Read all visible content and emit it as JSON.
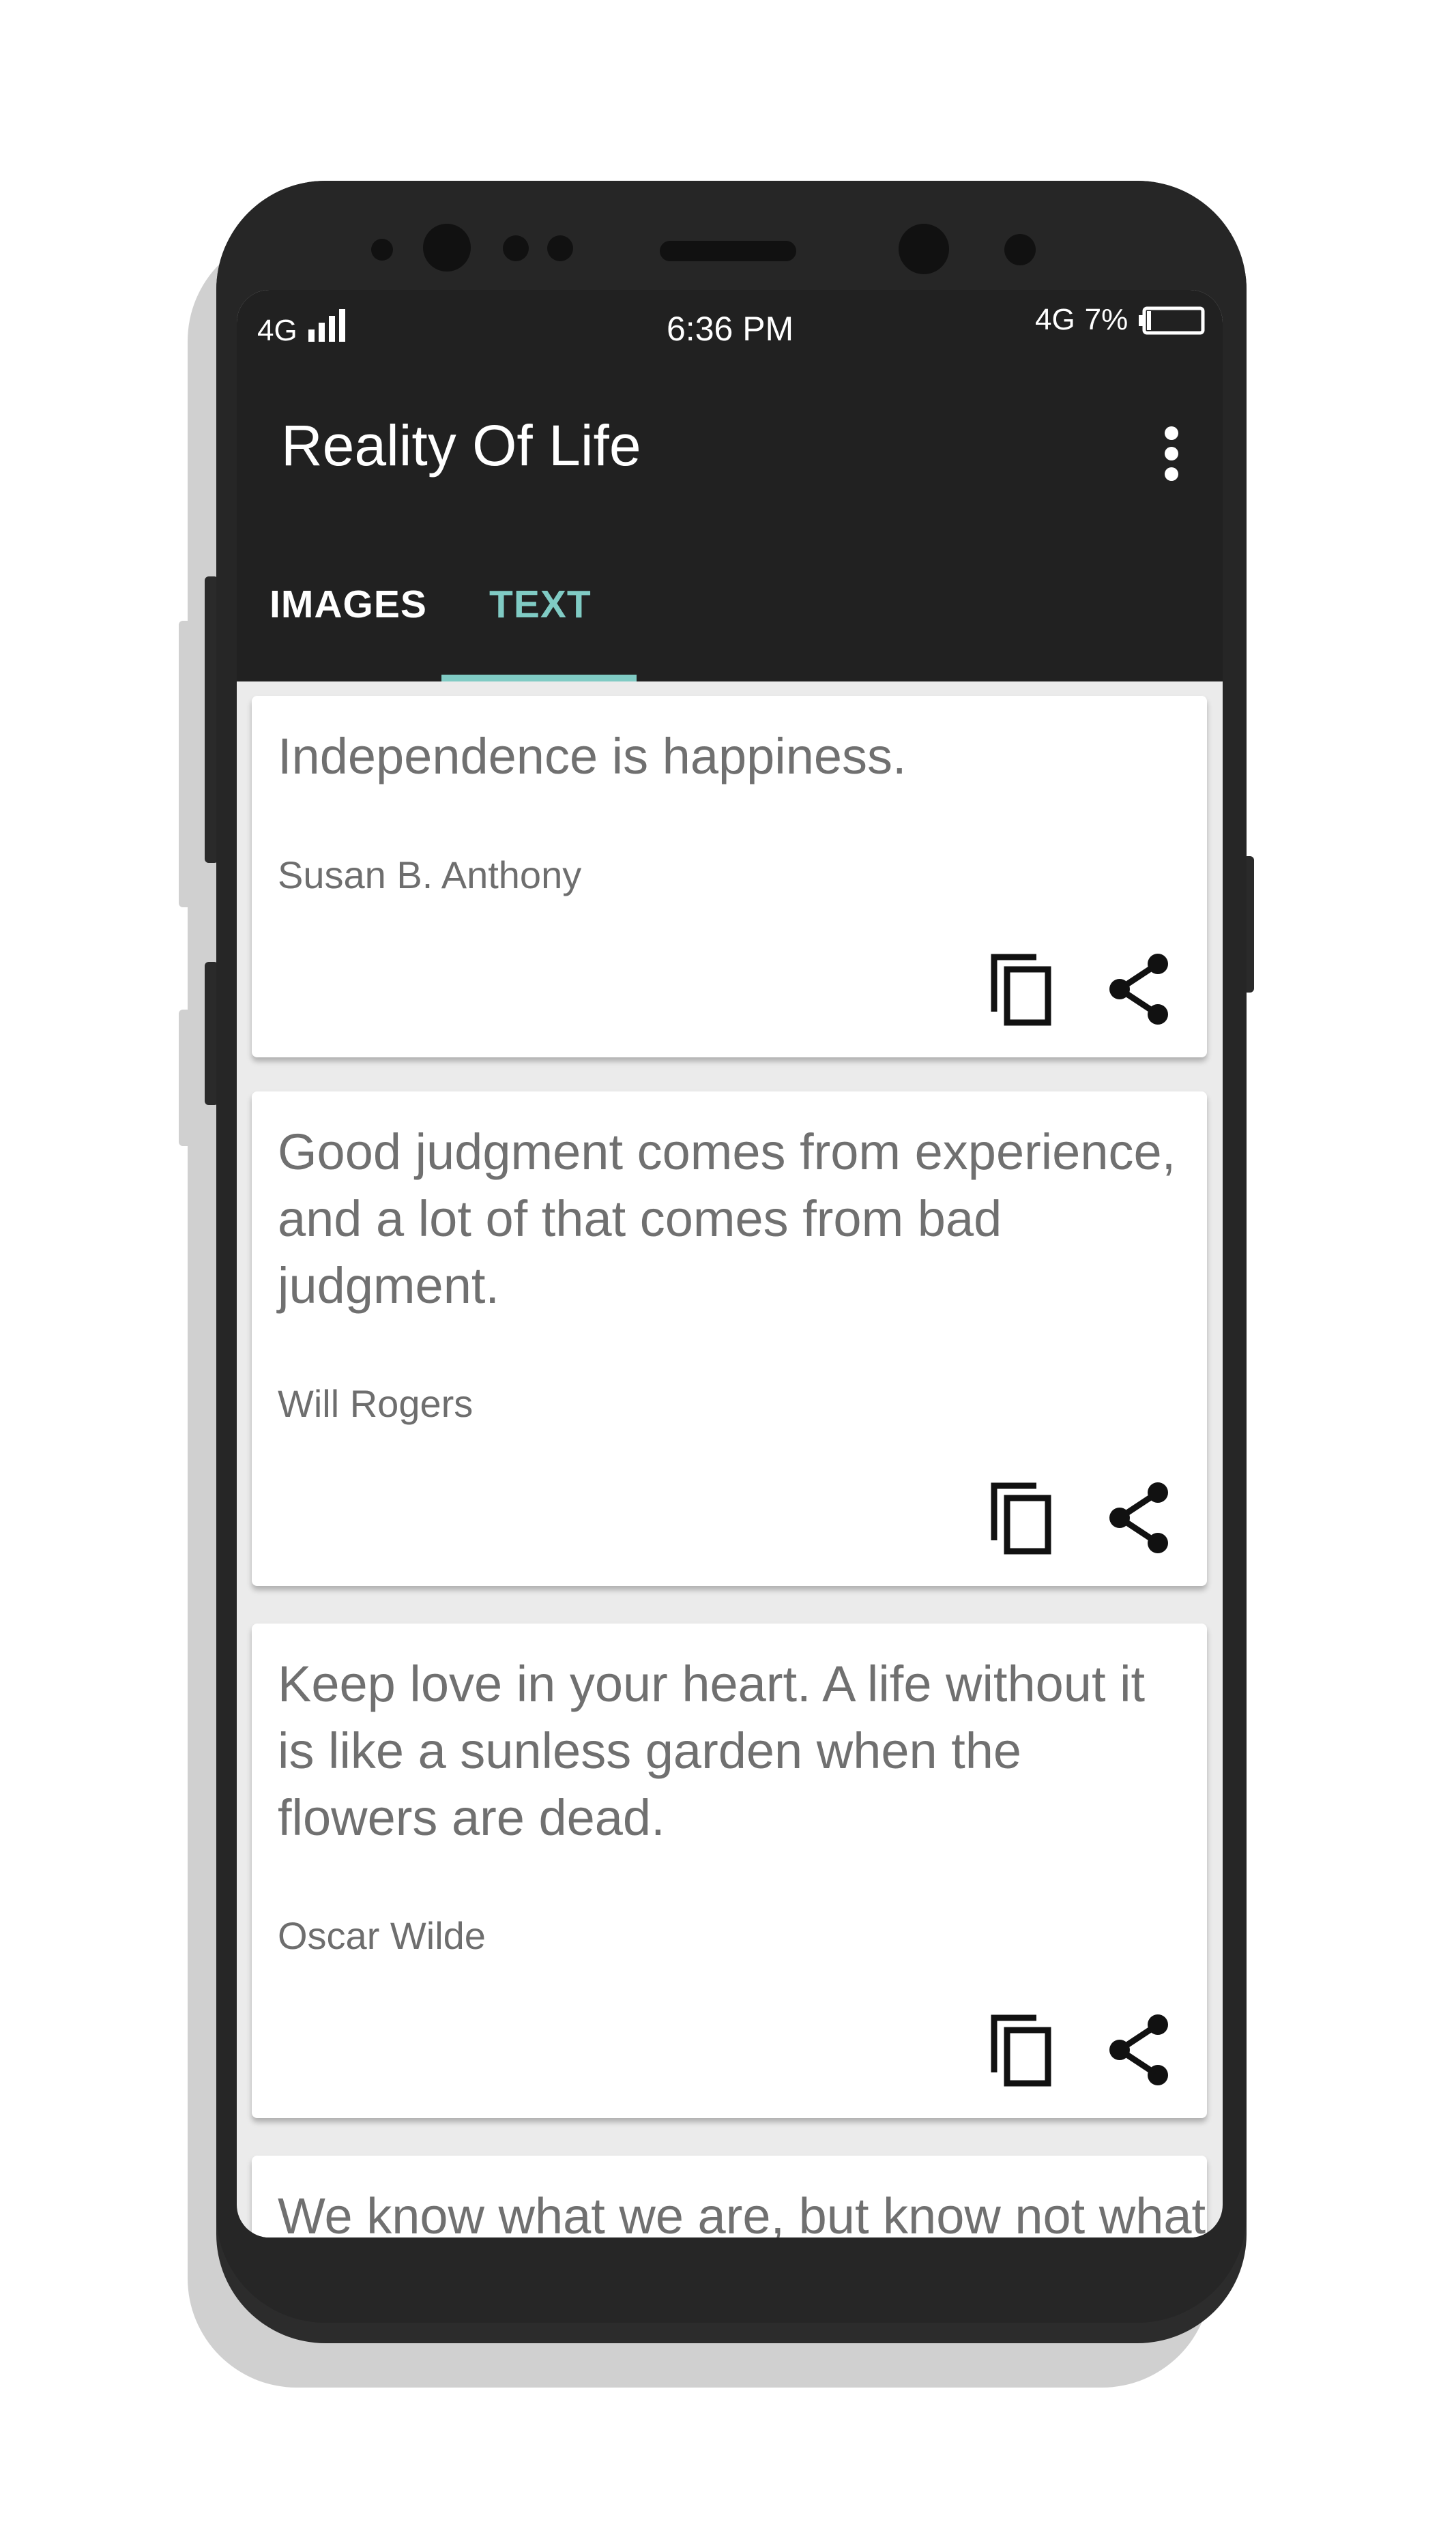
{
  "status_bar": {
    "network": "4G",
    "time": "6:36 PM",
    "data": "4G",
    "battery": "7%"
  },
  "app": {
    "title": "Reality Of Life",
    "menu_icon": "more-vert-icon"
  },
  "tabs": [
    {
      "label": "IMAGES",
      "selected": false
    },
    {
      "label": "TEXT",
      "selected": true
    }
  ],
  "colors": {
    "accent": "#80cbc4",
    "appbar": "#212121"
  },
  "quotes": [
    {
      "text": "Independence is happiness.",
      "author": "Susan B. Anthony",
      "actions": [
        "copy-icon",
        "share-icon"
      ]
    },
    {
      "text": "Good judgment comes from experience, and a lot of that comes from bad judgment.",
      "author": "Will Rogers",
      "actions": [
        "copy-icon",
        "share-icon"
      ]
    },
    {
      "text": "Keep love in your heart. A life without it is like a sunless garden when the flowers are dead.",
      "author": "Oscar Wilde",
      "actions": [
        "copy-icon",
        "share-icon"
      ]
    },
    {
      "text": "We know what we are, but know not what"
    }
  ]
}
